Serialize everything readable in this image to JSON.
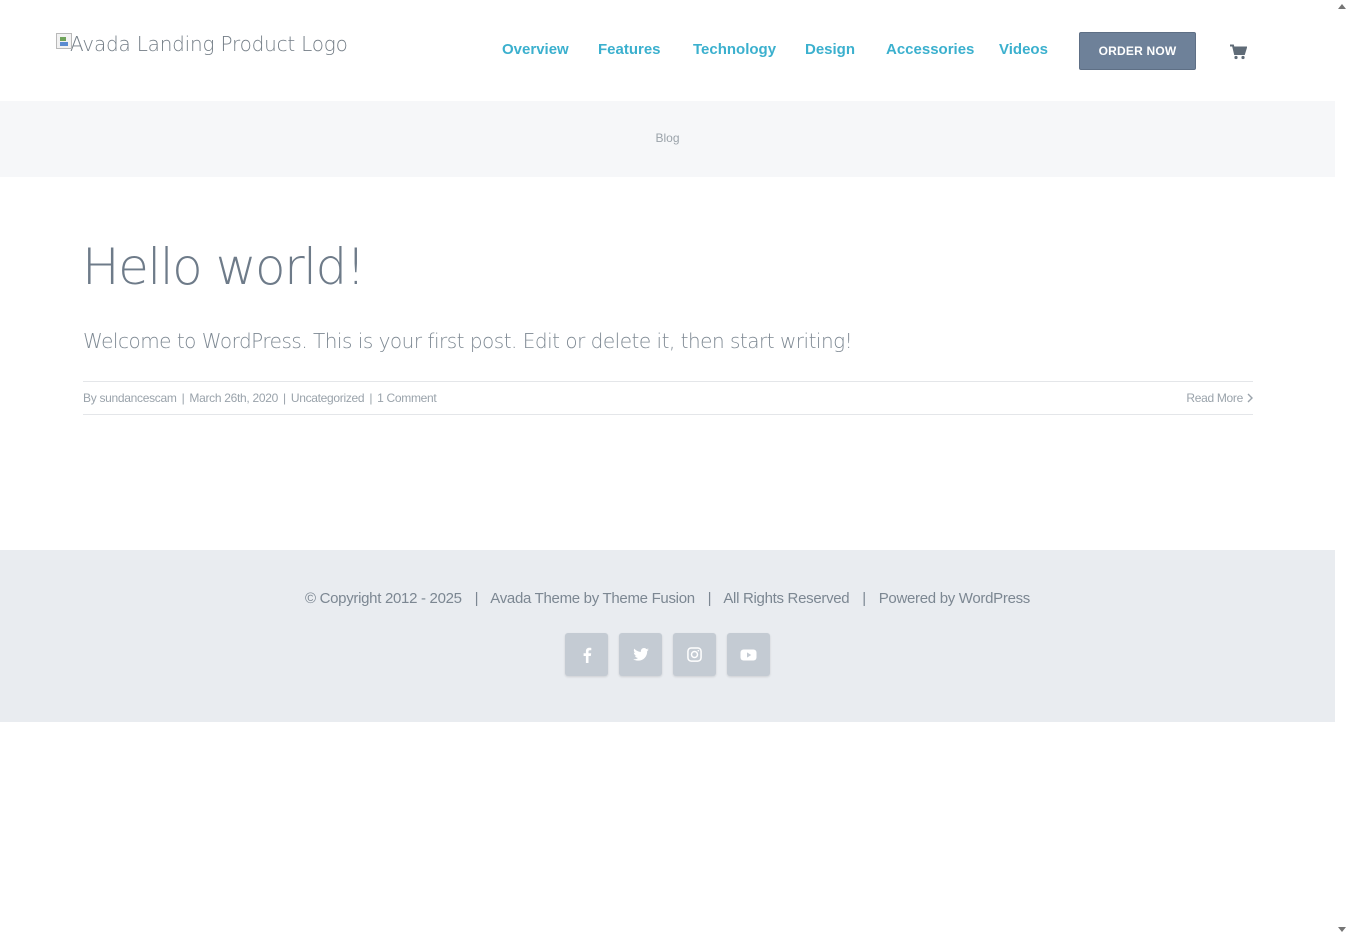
{
  "header": {
    "logo_alt": "Avada Landing Product Logo",
    "nav": [
      {
        "label": "Overview"
      },
      {
        "label": "Features"
      },
      {
        "label": "Technology"
      },
      {
        "label": "Design"
      },
      {
        "label": "Accessories"
      },
      {
        "label": "Videos"
      }
    ],
    "order_button": "ORDER NOW",
    "cart_icon": "shopping-cart-icon"
  },
  "title_bar": {
    "breadcrumb": "Blog"
  },
  "post": {
    "title": "Hello world!",
    "excerpt": "Welcome to WordPress. This is your first post. Edit or delete it, then start writing!",
    "meta": {
      "by_prefix": "By",
      "author": "sundancescam",
      "date": "March 26th, 2020",
      "category": "Uncategorized",
      "comments": "1 Comment",
      "separator": "|"
    },
    "read_more": "Read More"
  },
  "footer": {
    "copyright": "© Copyright 2012 - 2025",
    "theme_credit": "Avada Theme by Theme Fusion",
    "rights": "All Rights Reserved",
    "powered": "Powered by WordPress",
    "separator": "|",
    "social": [
      {
        "icon": "facebook-icon"
      },
      {
        "icon": "twitter-icon"
      },
      {
        "icon": "instagram-icon"
      },
      {
        "icon": "youtube-icon"
      }
    ]
  },
  "colors": {
    "nav_link": "#3bb0ce",
    "order_button_bg": "#6e8199",
    "footer_bg": "#e9ecf0",
    "title_bar_bg": "#f6f7f9",
    "social_icon_bg": "#c4cbd3"
  }
}
